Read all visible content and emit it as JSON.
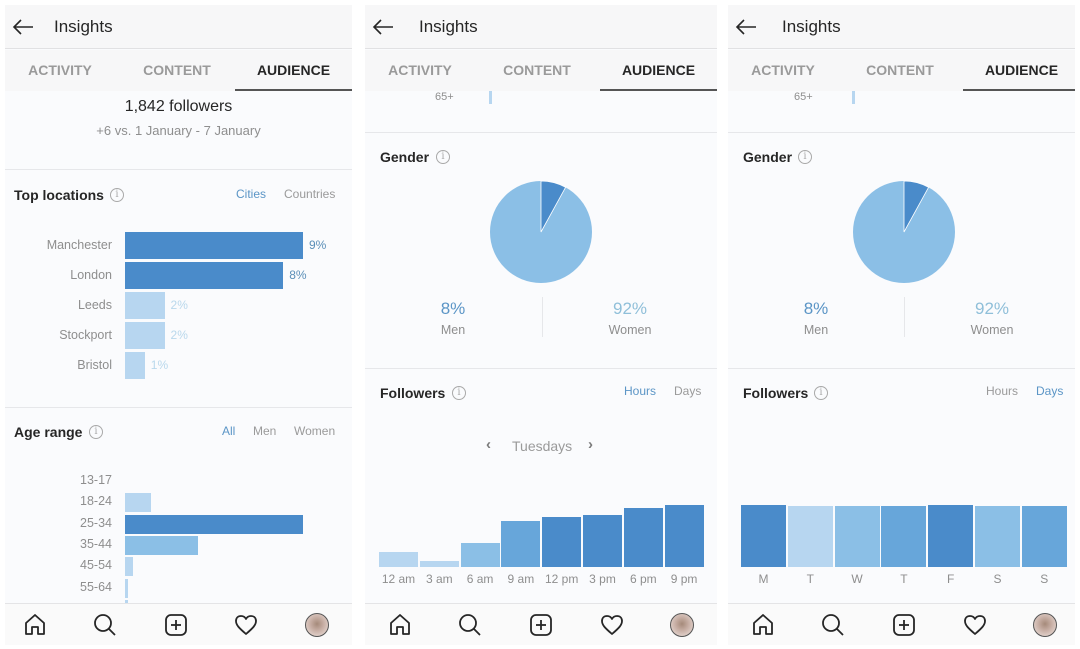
{
  "colors": {
    "dark": "#4a8bca",
    "mid": "#67a6da",
    "light": "#8bbfe6",
    "pale": "#b7d6f0",
    "accent_text": "#5b95c6",
    "muted_text": "#8e8e8e"
  },
  "header": {
    "title": "Insights",
    "back_icon": "arrow-left-icon"
  },
  "tabs": [
    "ACTIVITY",
    "CONTENT",
    "AUDIENCE"
  ],
  "active_tab": "AUDIENCE",
  "bottom_nav": [
    "home-icon",
    "search-icon",
    "new-post-icon",
    "heart-icon",
    "profile-avatar"
  ],
  "panel1": {
    "followers": "1,842 followers",
    "followers_change": "+6 vs. 1 January - 7 January",
    "top_locations": {
      "title": "Top locations",
      "filters": [
        "Cities",
        "Countries"
      ],
      "active_filter": "Cities"
    },
    "age_range": {
      "title": "Age range",
      "filters": [
        "All",
        "Men",
        "Women"
      ],
      "active_filter": "All"
    }
  },
  "panel2": {
    "scrolled_label": "65+",
    "gender": {
      "title": "Gender",
      "men_pct": "8%",
      "men_label": "Men",
      "women_pct": "92%",
      "women_label": "Women"
    },
    "followers": {
      "title": "Followers",
      "filters": [
        "Hours",
        "Days"
      ],
      "active_filter": "Hours",
      "day_label": "Tuesdays"
    }
  },
  "panel3": {
    "scrolled_label": "65+",
    "gender": {
      "title": "Gender",
      "men_pct": "8%",
      "men_label": "Men",
      "women_pct": "92%",
      "women_label": "Women"
    },
    "followers": {
      "title": "Followers",
      "filters": [
        "Hours",
        "Days"
      ],
      "active_filter": "Days"
    }
  },
  "chart_data": [
    {
      "type": "bar",
      "orientation": "horizontal",
      "title": "Top locations",
      "categories": [
        "Manchester",
        "London",
        "Leeds",
        "Stockport",
        "Bristol"
      ],
      "values": [
        9,
        8,
        2,
        2,
        1
      ],
      "labels": [
        "9%",
        "8%",
        "2%",
        "2%",
        "1%"
      ],
      "unit": "%"
    },
    {
      "type": "bar",
      "orientation": "horizontal",
      "title": "Age range",
      "categories": [
        "13-17",
        "18-24",
        "25-34",
        "35-44",
        "45-54",
        "55-64",
        "65+"
      ],
      "values": [
        0,
        4.4,
        30,
        12.3,
        1.3,
        0.3,
        0.2
      ],
      "unit": "relative share"
    },
    {
      "type": "pie",
      "title": "Gender",
      "categories": [
        "Men",
        "Women"
      ],
      "values": [
        8,
        92
      ]
    },
    {
      "type": "bar",
      "title": "Followers (Hours) - Tuesdays",
      "categories": [
        "12 am",
        "3 am",
        "6 am",
        "9 am",
        "12 pm",
        "3 pm",
        "6 pm",
        "9 pm"
      ],
      "values": [
        15,
        6,
        24,
        46,
        50,
        52,
        59,
        62
      ],
      "ylim": [
        0,
        100
      ],
      "unit": "relative activity"
    },
    {
      "type": "bar",
      "title": "Followers (Days)",
      "categories": [
        "M",
        "T",
        "W",
        "T",
        "F",
        "S",
        "S"
      ],
      "values": [
        62,
        61,
        61.5,
        61.5,
        62,
        61.5,
        61.5
      ],
      "ylim": [
        0,
        100
      ],
      "unit": "relative activity"
    }
  ]
}
